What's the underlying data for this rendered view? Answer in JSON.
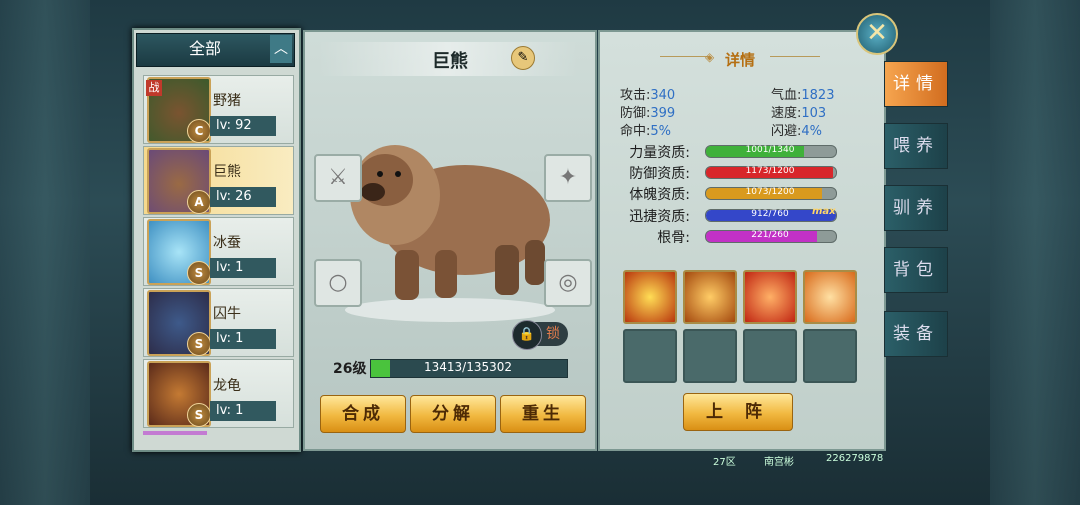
{
  "list": {
    "filter_label": "全部",
    "items": [
      {
        "name": "野猪",
        "level": "lv: 92",
        "grade": "C",
        "badge": "战"
      },
      {
        "name": "巨熊",
        "level": "lv: 26",
        "grade": "A"
      },
      {
        "name": "冰蚕",
        "level": "lv: 1",
        "grade": "S"
      },
      {
        "name": "囚牛",
        "level": "lv: 1",
        "grade": "S"
      },
      {
        "name": "龙龟",
        "level": "lv: 1",
        "grade": "S"
      }
    ]
  },
  "pet": {
    "name": "巨熊",
    "lock_label": "锁",
    "level_label": "26级",
    "xp_text": "13413/135302",
    "xp_fraction": 0.099
  },
  "actions": {
    "merge": "合成",
    "decompose": "分解",
    "rebirth": "重生",
    "deploy": "上 阵"
  },
  "details": {
    "title": "详情",
    "stats": [
      {
        "label": "攻击:",
        "value": "340"
      },
      {
        "label": "气血:",
        "value": "1823"
      },
      {
        "label": "防御:",
        "value": "399"
      },
      {
        "label": "速度:",
        "value": "103"
      },
      {
        "label": "命中:",
        "value": "5%"
      },
      {
        "label": "闪避:",
        "value": "4%"
      }
    ],
    "aptitudes": [
      {
        "label": "力量资质:",
        "text": "1001/1340",
        "fraction": 0.75,
        "color": "#3fb13a"
      },
      {
        "label": "防御资质:",
        "text": "1173/1200",
        "fraction": 0.98,
        "color": "#d8262a"
      },
      {
        "label": "体魄资质:",
        "text": "1073/1200",
        "fraction": 0.89,
        "color": "#d99a1e"
      },
      {
        "label": "迅捷资质:",
        "text": "912/760",
        "fraction": 1.0,
        "color": "#3447c9",
        "max": "max"
      },
      {
        "label": "根骨:",
        "text": "221/260",
        "fraction": 0.85,
        "color": "#c231c6"
      }
    ]
  },
  "tabs": [
    "详情",
    "喂养",
    "驯养",
    "背包",
    "装备"
  ],
  "footer": {
    "server": "27区",
    "player": "南宫彬",
    "id": "226279878"
  }
}
